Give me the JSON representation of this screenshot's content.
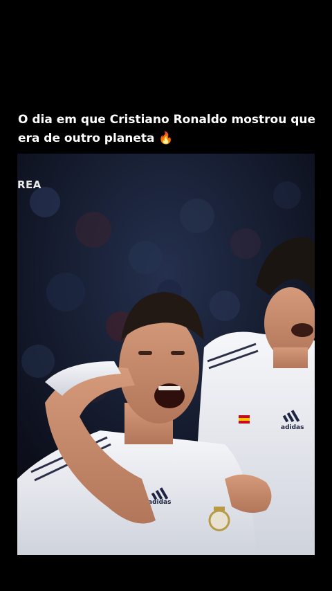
{
  "post": {
    "caption": "O dia em que Cristiano Ronaldo mostrou que era de outro planeta 🔥"
  },
  "video": {
    "watermark": "REA",
    "brand_mark_left": "adidas",
    "brand_mark_right": "adidas",
    "icons": [
      "fire-emoji",
      "adidas-logo",
      "real-madrid-crest",
      "spain-flag-badge"
    ]
  },
  "colors": {
    "background": "#000000",
    "caption_text": "#ffffff",
    "jersey": "#f2f3f6",
    "crowd": "#141a2e"
  }
}
